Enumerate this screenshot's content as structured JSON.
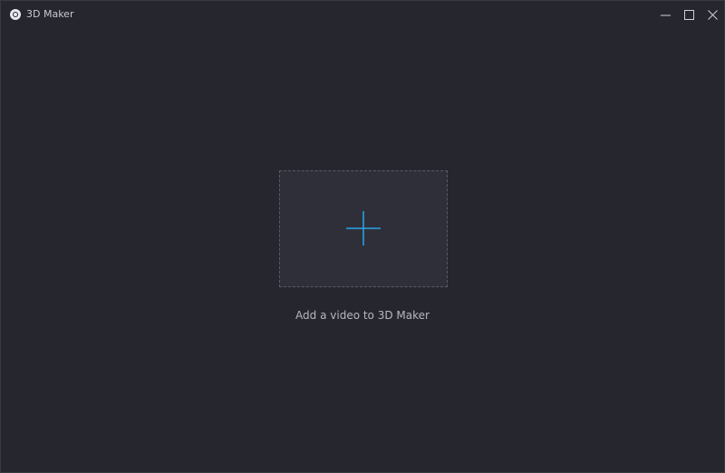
{
  "window": {
    "title": "3D Maker",
    "icon": "app-logo-icon",
    "controls": {
      "minimize_icon": "minimize-icon",
      "maximize_icon": "maximize-icon",
      "close_icon": "close-icon"
    }
  },
  "main": {
    "add_icon": "plus-icon",
    "hint": "Add a video to 3D Maker"
  },
  "colors": {
    "background": "#26262e",
    "dropzone_fill": "#2f2f3a",
    "dropzone_border": "#5a5a66",
    "accent": "#2aa3e8",
    "text": "#b7b7c0"
  }
}
